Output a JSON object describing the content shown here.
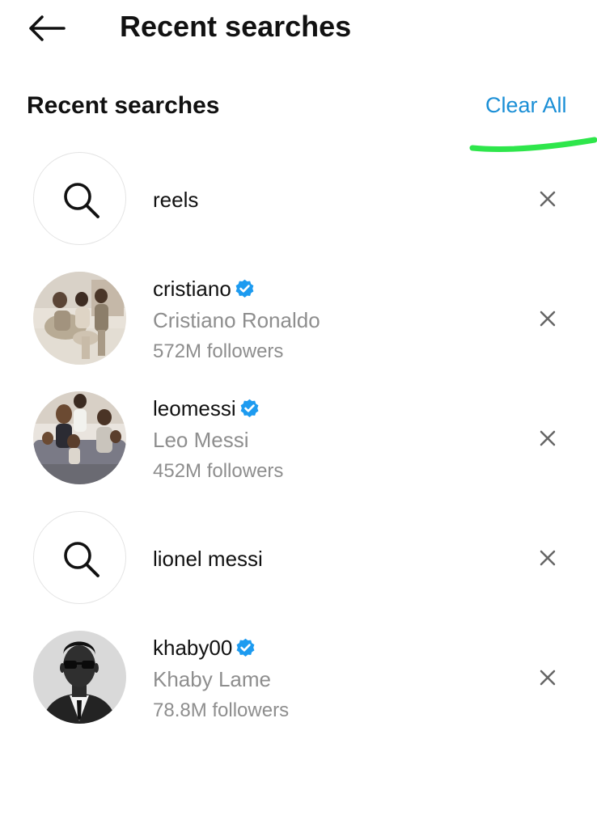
{
  "header": {
    "title": "Recent searches",
    "back_icon": "back-arrow-icon"
  },
  "section": {
    "heading": "Recent searches",
    "clear_all": "Clear All",
    "accent": "#1b8fd6"
  },
  "items": [
    {
      "type": "query",
      "text": "reels",
      "icon": "search-icon"
    },
    {
      "type": "account",
      "username": "cristiano",
      "full_name": "Cristiano Ronaldo",
      "followers": "572M followers",
      "verified": true
    },
    {
      "type": "account",
      "username": "leomessi",
      "full_name": "Leo Messi",
      "followers": "452M followers",
      "verified": true
    },
    {
      "type": "query",
      "text": "lionel messi",
      "icon": "search-icon"
    },
    {
      "type": "account",
      "username": "khaby00",
      "full_name": "Khaby Lame",
      "followers": "78.8M followers",
      "verified": true
    }
  ],
  "colors": {
    "verified": "#1d9bf0",
    "muted_text": "#8e8e8e",
    "highlight_stroke": "#2ee64b"
  }
}
